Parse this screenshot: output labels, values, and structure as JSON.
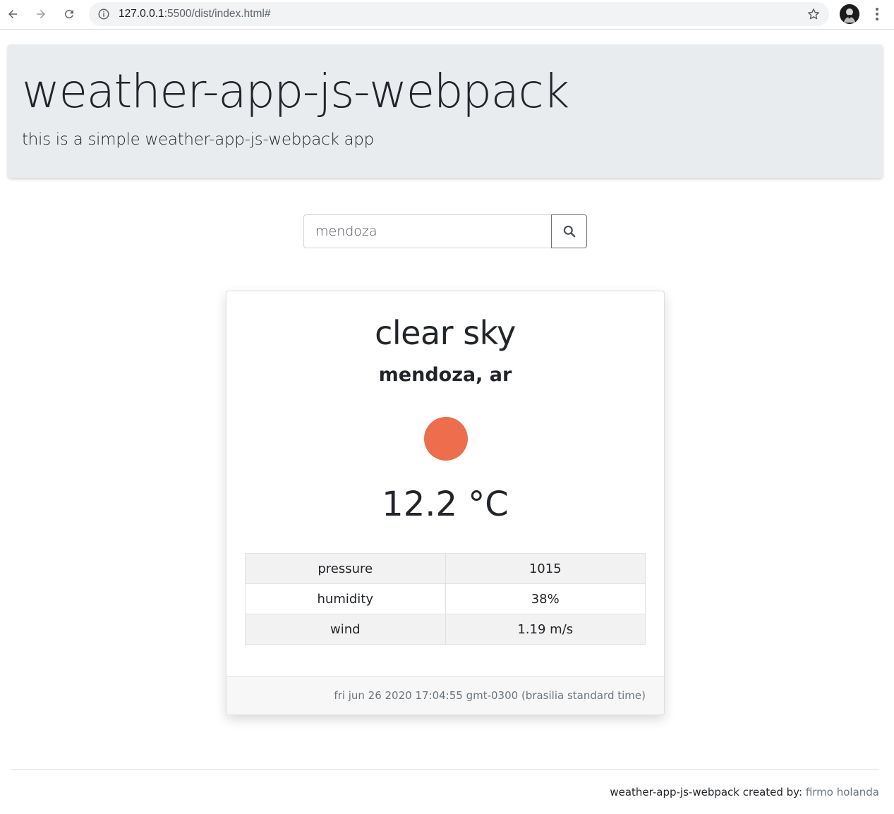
{
  "browser": {
    "url_host": "127.0.0.1",
    "url_path": ":5500/dist/index.html#"
  },
  "header": {
    "title": "weather-app-js-webpack",
    "subtitle": "this is a simple weather-app-js-webpack app"
  },
  "search": {
    "value": "mendoza",
    "button_icon": "search-icon"
  },
  "weather": {
    "condition": "clear sky",
    "location": "mendoza, ar",
    "icon": "sun-icon",
    "icon_color": "#ec6e4c",
    "temperature": "12.2 °C",
    "details": [
      {
        "label": "pressure",
        "value": "1015"
      },
      {
        "label": "humidity",
        "value": "38%"
      },
      {
        "label": "wind",
        "value": "1.19 m/s"
      }
    ],
    "timestamp": "fri jun 26 2020 17:04:55 gmt-0300 (brasilia standard time)"
  },
  "footer": {
    "text": "weather-app-js-webpack created by:",
    "author": "firmo holanda"
  }
}
